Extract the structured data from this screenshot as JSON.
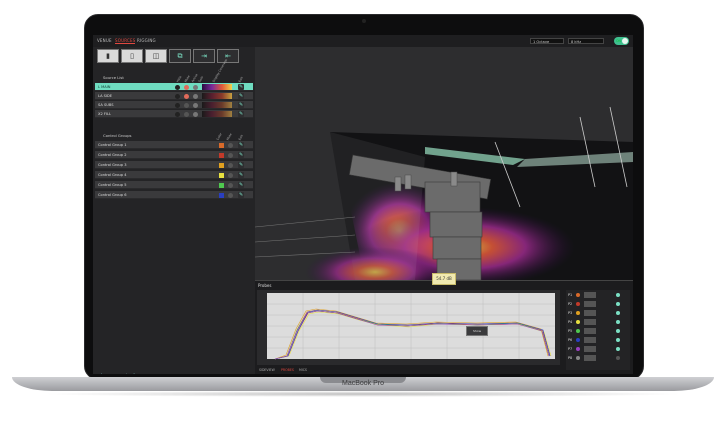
{
  "device": {
    "brand": "MacBook Pro"
  },
  "topbar": {
    "tabs": [
      {
        "label": "VENUE"
      },
      {
        "label": "SOURCES"
      },
      {
        "label": "RIGGING"
      }
    ],
    "resolution_select": "1 Octave",
    "frequency_select": "8 kHz",
    "toggle_label": "ON"
  },
  "source_list": {
    "title": "Source List",
    "columns": [
      "Hide",
      "Mute",
      "Active",
      "Solo",
      "Display Coverage",
      "Edit"
    ],
    "rows": [
      {
        "label": "L MAIN",
        "selected": true
      },
      {
        "label": "LA SIDE",
        "selected": false
      },
      {
        "label": "SA SUBS",
        "selected": false
      },
      {
        "label": "X2 FILL",
        "selected": false
      }
    ]
  },
  "control_groups": {
    "title": "Control Groups",
    "columns": [
      "Color",
      "Mute",
      "Edit"
    ],
    "rows": [
      {
        "label": "Control Group 1",
        "color": "#d86a2a"
      },
      {
        "label": "Control Group 2",
        "color": "#c23a2a"
      },
      {
        "label": "Control Group 3",
        "color": "#e0a020"
      },
      {
        "label": "Control Group 4",
        "color": "#e8e040"
      },
      {
        "label": "Control Group 5",
        "color": "#4fc84f"
      },
      {
        "label": "Control Group 6",
        "color": "#2a3fc0"
      }
    ]
  },
  "probes": {
    "title": "Probes",
    "footer_tabs": [
      {
        "label": "SIDEVIEW"
      },
      {
        "label": "PROBES"
      },
      {
        "label": "MICS"
      }
    ],
    "active_footer_tab": "PROBES",
    "tooltip": "54.7 dB",
    "show_button": "Show Collision",
    "probe_rows": [
      {
        "label": "P1",
        "color": "#d86a2a"
      },
      {
        "label": "P2",
        "color": "#c23a2a"
      },
      {
        "label": "P3",
        "color": "#e0a020"
      },
      {
        "label": "P4",
        "color": "#e8e040"
      },
      {
        "label": "P5",
        "color": "#4fc84f"
      },
      {
        "label": "P6",
        "color": "#2a3fc0"
      },
      {
        "label": "P7",
        "color": "#9a3fc0"
      },
      {
        "label": "P8",
        "color": "#888888"
      }
    ]
  },
  "colors": {
    "accent": "#6fdcc0",
    "alert": "#e0473f"
  }
}
